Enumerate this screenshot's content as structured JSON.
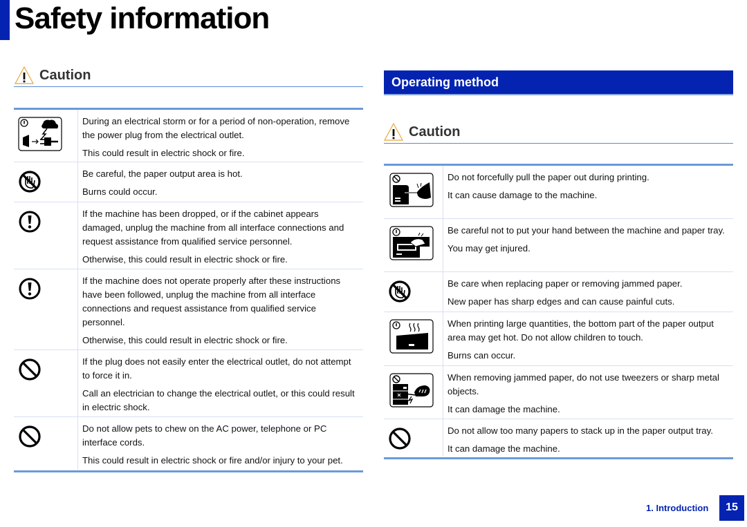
{
  "page": {
    "title": "Safety information",
    "accent_color": "#0323b0",
    "rule_color": "#6a9ad8"
  },
  "left": {
    "caution_label": "Caution",
    "rows": [
      {
        "icon": "storm-unplug-icon",
        "paragraphs": [
          "During an electrical storm or for a period of non-operation, remove the power plug from the electrical outlet.",
          "This could result in electric shock or fire."
        ]
      },
      {
        "icon": "no-touch-hand-icon",
        "paragraphs": [
          "Be careful, the paper output area is hot.",
          "Burns could occur."
        ]
      },
      {
        "icon": "exclamation-circle-icon",
        "paragraphs": [
          "If the machine has been dropped, or if the cabinet appears damaged, unplug the machine from all interface connections and request assistance from qualified service personnel.",
          "Otherwise, this could result in electric shock or fire."
        ]
      },
      {
        "icon": "exclamation-circle-icon",
        "paragraphs": [
          "If the machine does not operate properly after these instructions have been followed, unplug the machine from all interface connections and request assistance from qualified service personnel.",
          "Otherwise, this could result in electric shock or fire."
        ]
      },
      {
        "icon": "prohibited-icon",
        "paragraphs": [
          "If the plug does not easily enter the electrical outlet, do not attempt to force it in.",
          "Call an electrician to change the electrical outlet, or this could result in electric shock."
        ]
      },
      {
        "icon": "prohibited-icon",
        "paragraphs": [
          "Do not allow pets to chew on the AC power, telephone or PC interface cords.",
          "This could result in electric shock or fire and/or injury to your pet."
        ]
      }
    ]
  },
  "right": {
    "section_title": "Operating method",
    "caution_label": "Caution",
    "rows": [
      {
        "icon": "no-pull-paper-icon",
        "paragraphs": [
          "Do not forcefully pull the paper out during printing.",
          "It can cause damage to the machine."
        ]
      },
      {
        "icon": "hand-in-tray-icon",
        "paragraphs": [
          "Be careful not to put your hand between the machine and paper tray.",
          "You may get injured."
        ]
      },
      {
        "icon": "no-touch-hand-icon",
        "paragraphs": [
          "Be care when replacing paper or removing jammed paper.",
          "New paper has sharp edges and can cause painful cuts."
        ]
      },
      {
        "icon": "hot-output-icon",
        "paragraphs": [
          "When printing large quantities, the bottom part of the paper output area may get hot. Do not allow children to touch.",
          "Burns can occur."
        ]
      },
      {
        "icon": "no-tweezers-icon",
        "paragraphs": [
          "When removing jammed paper, do not use tweezers or sharp metal objects.",
          "It can damage the machine."
        ]
      },
      {
        "icon": "prohibited-icon",
        "paragraphs": [
          "Do not allow too many papers to stack up in the paper output tray.",
          "It can damage the machine."
        ]
      }
    ]
  },
  "footer": {
    "section": "1. Introduction",
    "page_number": "15"
  }
}
